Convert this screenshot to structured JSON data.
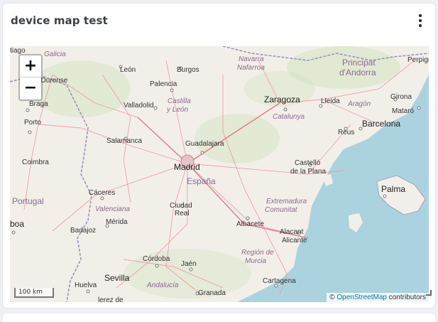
{
  "widget": {
    "title": "device map test",
    "menu_icon": "kebab-vertical-icon"
  },
  "map": {
    "zoom_in": "+",
    "zoom_out": "−",
    "scale_label": "100 km",
    "attribution": {
      "prefix": "©",
      "link": "OpenStreetMap",
      "suffix": " contributors"
    },
    "countries": [
      "Portugal",
      "España"
    ],
    "regions": [
      "Galicia",
      "Navarra",
      "Nafarroa",
      "Principat",
      "d'Andorra",
      "Castilla",
      "y León",
      "Aragón",
      "Catalunya",
      "Extremadura",
      "Comunitat",
      "Valenciana",
      "Región de",
      "Murcia",
      "Andalucía"
    ],
    "cities": [
      "tiago",
      "León",
      "Burgos",
      "Ourense",
      "Palencia",
      "Perpign",
      "Braga",
      "Valladolid",
      "Zaragoza",
      "Lleida",
      "Girona",
      "Mataró",
      "Porto",
      "Reus",
      "Barcelona",
      "Salamanca",
      "Guadalajara",
      "Coimbra",
      "Madrid",
      "Castelló",
      "de la Plana",
      "Palma",
      "Cáceres",
      "Ciudad",
      "Real",
      "boa",
      "Mérida",
      "Badajoz",
      "Albacete",
      "Alacant",
      "Alicante",
      "Córdoba",
      "Jaén",
      "Sevilla",
      "Huelva",
      "Granada",
      "Cartagena",
      "lerez de"
    ]
  },
  "colors": {
    "land": "#f2efe9",
    "sea": "#aad3df",
    "border": "#9e93b8",
    "road": "#e89aa2",
    "link": "#0078a8"
  }
}
